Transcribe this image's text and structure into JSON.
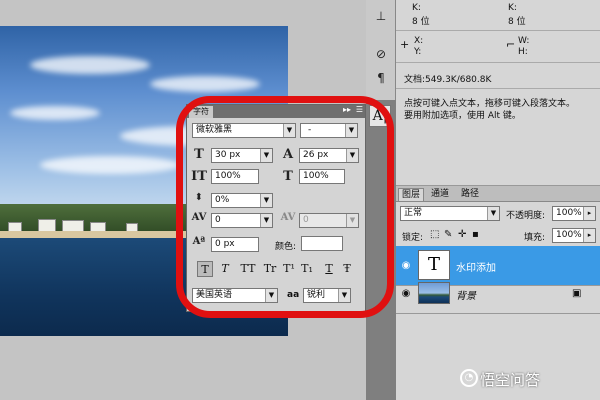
{
  "info": {
    "k_label": "K:",
    "k_label2": "K:",
    "bits_left": "8 位",
    "bits_right": "8 位",
    "x_label": "X:",
    "y_label": "Y:",
    "w_label": "W:",
    "h_label": "H:",
    "doc_size": "文档:549.3K/680.8K",
    "hint_line1": "点按可键入点文本，拖移可键入段落文本。",
    "hint_line2": "要用附加选项，使用 Alt 键。"
  },
  "layers_panel": {
    "tabs": [
      "图层",
      "通道",
      "路径"
    ],
    "blend_mode": "正常",
    "opacity_label": "不透明度:",
    "opacity_value": "100%",
    "lock_label": "锁定:",
    "fill_label": "填充:",
    "fill_value": "100%",
    "layers": [
      {
        "name": "水印添加",
        "selected": true,
        "thumb_text": "T"
      },
      {
        "name": "背景",
        "selected": false
      }
    ]
  },
  "character_panel": {
    "tab_label": "字符",
    "font_family": "微软雅黑",
    "font_style": "-",
    "font_size": "30 px",
    "leading": "26 px",
    "vertical_scale": "100%",
    "horizontal_scale": "100%",
    "kerning": "0%",
    "tracking": "0",
    "kern_metric": "0",
    "baseline_shift": "0 px",
    "color_label": "颜色:",
    "color_value": "#ffffff",
    "format_buttons": [
      "T",
      "T",
      "TT",
      "Tr",
      "T¹",
      "T₁",
      "T",
      "Ŧ"
    ],
    "language": "美国英语",
    "aa_label": "aa",
    "antialias": "锐利"
  },
  "toolstrip": {
    "char_button": "A|"
  },
  "watermark": {
    "text": "悟空问答"
  },
  "colors": {
    "selected_layer": "#3a9ae6",
    "highlight": "#e01010"
  }
}
